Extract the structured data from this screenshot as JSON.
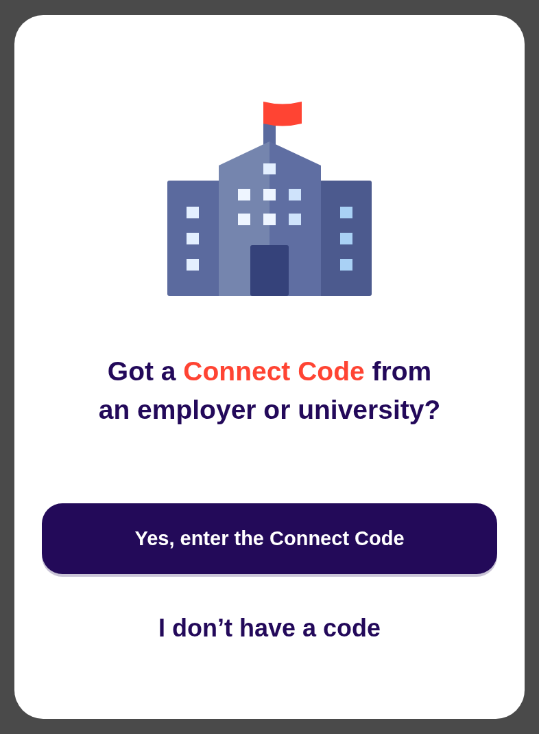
{
  "prompt": {
    "lines": [
      [
        {
          "text": "Got a ",
          "highlight": false
        },
        {
          "text": "Connect Code",
          "highlight": true
        },
        {
          "text": " from",
          "highlight": false
        }
      ],
      [
        {
          "text": "an employer or university?",
          "highlight": false
        }
      ]
    ]
  },
  "primary_button": {
    "label": "Yes, enter the Connect Code"
  },
  "secondary_link": {
    "label": "I don’t have a code"
  }
}
